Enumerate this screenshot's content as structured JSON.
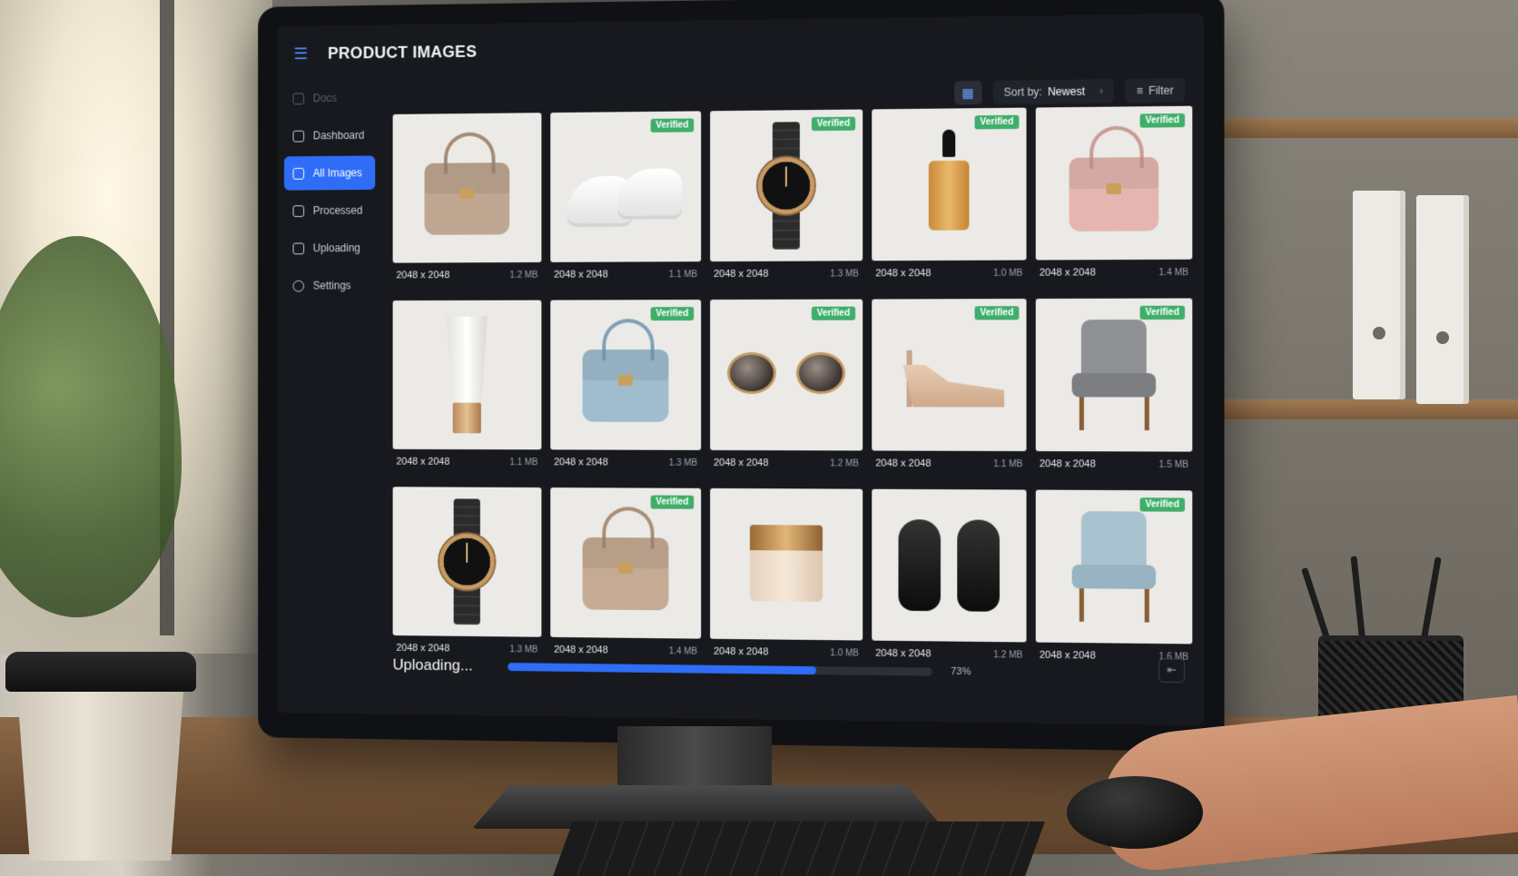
{
  "app": {
    "title": "PRODUCT IMAGES",
    "menu_icon": "menu-icon"
  },
  "sidebar": {
    "items": [
      {
        "label": "Docs",
        "icon": "home-icon",
        "state": "muted"
      },
      {
        "label": "Dashboard",
        "icon": "dashboard-icon",
        "state": "normal"
      },
      {
        "label": "All Images",
        "icon": "images-icon",
        "state": "active"
      },
      {
        "label": "Processed",
        "icon": "document-icon",
        "state": "normal"
      },
      {
        "label": "Uploading",
        "icon": "upload-icon",
        "state": "normal"
      },
      {
        "label": "Settings",
        "icon": "gear-icon",
        "state": "normal"
      }
    ]
  },
  "toolbar": {
    "view_icon": "grid-view-icon",
    "sort_label": "Sort by:",
    "sort_value": "Newest",
    "filter_label": "Filter"
  },
  "badge_text": "Verified",
  "images": [
    {
      "product": "handbag-taupe",
      "dimensions": "2048 x 2048",
      "size": "1.2 MB",
      "verified": false
    },
    {
      "product": "white-sneakers",
      "dimensions": "2048 x 2048",
      "size": "1.1 MB",
      "verified": true
    },
    {
      "product": "gold-watch",
      "dimensions": "2048 x 2048",
      "size": "1.3 MB",
      "verified": true
    },
    {
      "product": "serum-bottle",
      "dimensions": "2048 x 2048",
      "size": "1.0 MB",
      "verified": true
    },
    {
      "product": "handbag-pink",
      "dimensions": "2048 x 2048",
      "size": "1.4 MB",
      "verified": true
    },
    {
      "product": "cosmetic-tube",
      "dimensions": "2048 x 2048",
      "size": "1.1 MB",
      "verified": false
    },
    {
      "product": "handbag-blue",
      "dimensions": "2048 x 2048",
      "size": "1.3 MB",
      "verified": true
    },
    {
      "product": "sunglasses",
      "dimensions": "2048 x 2048",
      "size": "1.2 MB",
      "verified": true
    },
    {
      "product": "nude-heels",
      "dimensions": "2048 x 2048",
      "size": "1.1 MB",
      "verified": true
    },
    {
      "product": "grey-armchair",
      "dimensions": "2048 x 2048",
      "size": "1.5 MB",
      "verified": true
    },
    {
      "product": "gold-watch",
      "dimensions": "2048 x 2048",
      "size": "1.3 MB",
      "verified": false
    },
    {
      "product": "handbag-beige",
      "dimensions": "2048 x 2048",
      "size": "1.4 MB",
      "verified": true
    },
    {
      "product": "cream-jar",
      "dimensions": "2048 x 2048",
      "size": "1.0 MB",
      "verified": false
    },
    {
      "product": "black-oxfords",
      "dimensions": "2048 x 2048",
      "size": "1.2 MB",
      "verified": false
    },
    {
      "product": "blue-armchair",
      "dimensions": "2048 x 2048",
      "size": "1.6 MB",
      "verified": true
    }
  ],
  "upload": {
    "label": "Uploading...",
    "percent_text": "73%",
    "progress": 0.73
  },
  "colors": {
    "accent": "#2f6df6",
    "verified": "#3fae6a",
    "screen_bg": "#17191e"
  }
}
